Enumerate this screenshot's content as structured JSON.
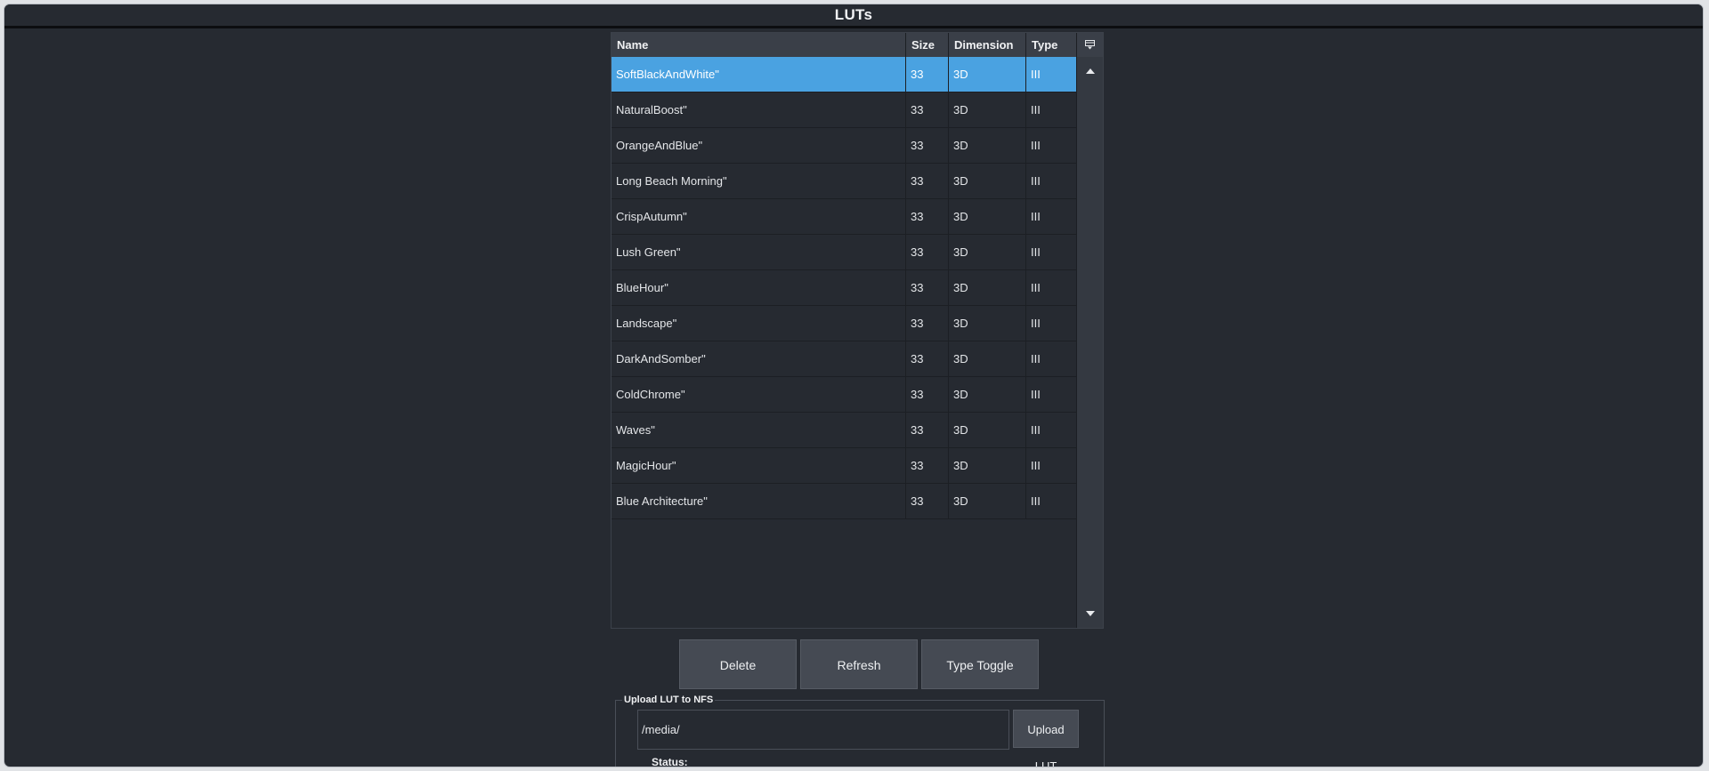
{
  "window": {
    "title": "LUTs"
  },
  "table": {
    "columns": [
      "Name",
      "Size",
      "Dimension",
      "Type"
    ],
    "rows": [
      {
        "name": "SoftBlackAndWhite\"",
        "size": "33",
        "dimension": "3D",
        "type": "III",
        "selected": true
      },
      {
        "name": "NaturalBoost\"",
        "size": "33",
        "dimension": "3D",
        "type": "III"
      },
      {
        "name": "OrangeAndBlue\"",
        "size": "33",
        "dimension": "3D",
        "type": "III"
      },
      {
        "name": "Long Beach Morning\"",
        "size": "33",
        "dimension": "3D",
        "type": "III"
      },
      {
        "name": "CrispAutumn\"",
        "size": "33",
        "dimension": "3D",
        "type": "III"
      },
      {
        "name": "Lush Green\"",
        "size": "33",
        "dimension": "3D",
        "type": "III"
      },
      {
        "name": "BlueHour\"",
        "size": "33",
        "dimension": "3D",
        "type": "III"
      },
      {
        "name": "Landscape\"",
        "size": "33",
        "dimension": "3D",
        "type": "III"
      },
      {
        "name": "DarkAndSomber\"",
        "size": "33",
        "dimension": "3D",
        "type": "III"
      },
      {
        "name": "ColdChrome\"",
        "size": "33",
        "dimension": "3D",
        "type": "III"
      },
      {
        "name": "Waves\"",
        "size": "33",
        "dimension": "3D",
        "type": "III"
      },
      {
        "name": "MagicHour\"",
        "size": "33",
        "dimension": "3D",
        "type": "III"
      },
      {
        "name": "Blue Architecture\"",
        "size": "33",
        "dimension": "3D",
        "type": "III"
      }
    ]
  },
  "actions": {
    "delete_label": "Delete",
    "refresh_label": "Refresh",
    "type_toggle_label": "Type Toggle"
  },
  "upload": {
    "group_label": "Upload LUT to NFS",
    "path_value": "/media/",
    "button_label": "Upload LUT",
    "status_label": "Status:"
  },
  "colors": {
    "background": "#262a31",
    "header": "#3a3f48",
    "selected_row": "#4aa2e1",
    "button": "#454a53"
  },
  "icons": {
    "corner": "column-chooser-icon",
    "scroll_up": "scroll-up-arrow-icon",
    "scroll_down": "scroll-down-arrow-icon"
  }
}
